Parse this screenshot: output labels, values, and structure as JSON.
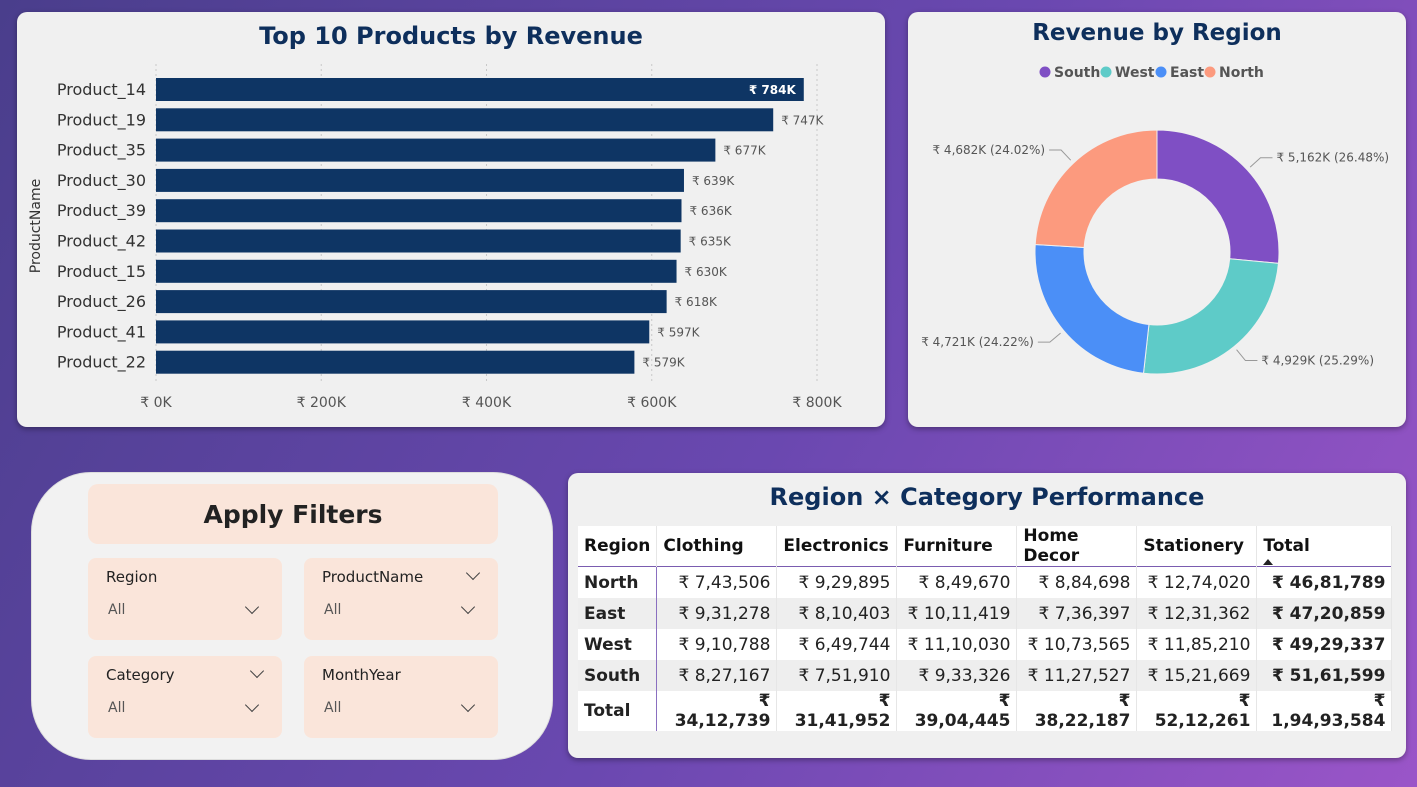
{
  "bar_chart": {
    "title": "Top 10 Products by Revenue",
    "ylabel": "ProductName",
    "bar_color": "#0e3564"
  },
  "donut_chart": {
    "title": "Revenue by Region"
  },
  "filters": {
    "title": "Apply Filters",
    "slicers": [
      {
        "label": "Region",
        "value": "All"
      },
      {
        "label": "ProductName",
        "value": "All"
      },
      {
        "label": "Category",
        "value": "All"
      },
      {
        "label": "MonthYear",
        "value": "All"
      }
    ],
    "panel_color": "#fae5da"
  },
  "matrix": {
    "title": "Region × Category Performance",
    "columns": [
      "Region",
      "Clothing",
      "Electronics",
      "Furniture",
      "Home Decor",
      "Stationery",
      "Total"
    ],
    "rows": [
      [
        "North",
        "₹ 7,43,506",
        "₹ 9,29,895",
        "₹ 8,49,670",
        "₹ 8,84,698",
        "₹ 12,74,020",
        "₹ 46,81,789"
      ],
      [
        "East",
        "₹ 9,31,278",
        "₹ 8,10,403",
        "₹ 10,11,419",
        "₹ 7,36,397",
        "₹ 12,31,362",
        "₹ 47,20,859"
      ],
      [
        "West",
        "₹ 9,10,788",
        "₹ 6,49,744",
        "₹ 11,10,030",
        "₹ 10,73,565",
        "₹ 11,85,210",
        "₹ 49,29,337"
      ],
      [
        "South",
        "₹ 8,27,167",
        "₹ 7,51,910",
        "₹ 9,33,326",
        "₹ 11,27,527",
        "₹ 15,21,669",
        "₹ 51,61,599"
      ],
      [
        "Total",
        "₹ 34,12,739",
        "₹ 31,41,952",
        "₹ 39,04,445",
        "₹ 38,22,187",
        "₹ 52,12,261",
        "₹ 1,94,93,584"
      ]
    ]
  },
  "chart_data": [
    {
      "type": "bar",
      "orientation": "horizontal",
      "title": "Top 10 Products by Revenue",
      "ylabel": "ProductName",
      "xlabel": "",
      "categories": [
        "Product_14",
        "Product_19",
        "Product_35",
        "Product_30",
        "Product_39",
        "Product_42",
        "Product_15",
        "Product_26",
        "Product_41",
        "Product_22"
      ],
      "values": [
        784000,
        747000,
        677000,
        639000,
        636000,
        635000,
        630000,
        618000,
        597000,
        579000
      ],
      "data_labels": [
        "₹ 784K",
        "₹ 747K",
        "₹ 677K",
        "₹ 639K",
        "₹ 636K",
        "₹ 635K",
        "₹ 630K",
        "₹ 618K",
        "₹ 597K",
        "₹ 579K"
      ],
      "xlim": [
        0,
        800000
      ],
      "xticks": [
        0,
        200000,
        400000,
        600000,
        800000
      ],
      "xtick_labels": [
        "₹ 0K",
        "₹ 200K",
        "₹ 400K",
        "₹ 600K",
        "₹ 800K"
      ],
      "grid": true
    },
    {
      "type": "pie",
      "variant": "donut",
      "title": "Revenue by Region",
      "legend_position": "top",
      "categories": [
        "South",
        "West",
        "East",
        "North"
      ],
      "values": [
        5162,
        4929,
        4721,
        4682
      ],
      "data_labels": [
        "₹ 5,162K (26.48%)",
        "₹ 4,929K (25.29%)",
        "₹ 4,721K (24.22%)",
        "₹ 4,682K (24.02%)"
      ],
      "colors": [
        "#7f4fc4",
        "#5ecbc8",
        "#4b8ff7",
        "#fc9a7e"
      ]
    }
  ]
}
